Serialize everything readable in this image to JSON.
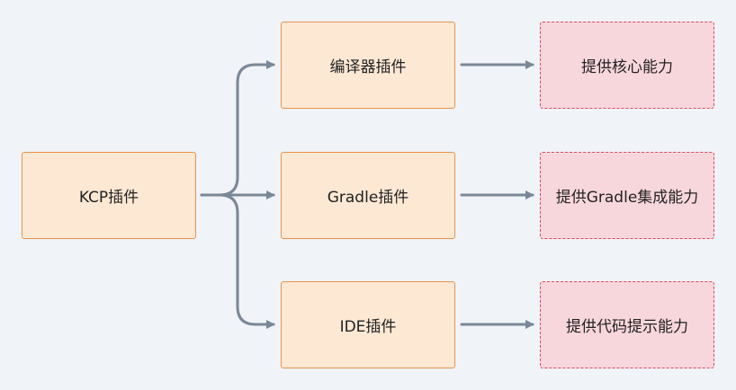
{
  "nodes": {
    "root": "KCP插件",
    "compiler_plugin": "编译器插件",
    "gradle_plugin": "Gradle插件",
    "ide_plugin": "IDE插件",
    "core_ability": "提供核心能力",
    "gradle_ability": "提供Gradle集成能力",
    "ide_ability": "提供代码提示能力"
  },
  "colors": {
    "plugin_fill": "#fde8d4",
    "plugin_border": "#e8934a",
    "ability_fill": "#f8d7dc",
    "ability_border": "#d9485f",
    "connector": "#7a8797",
    "background": "#f0f3f7"
  }
}
